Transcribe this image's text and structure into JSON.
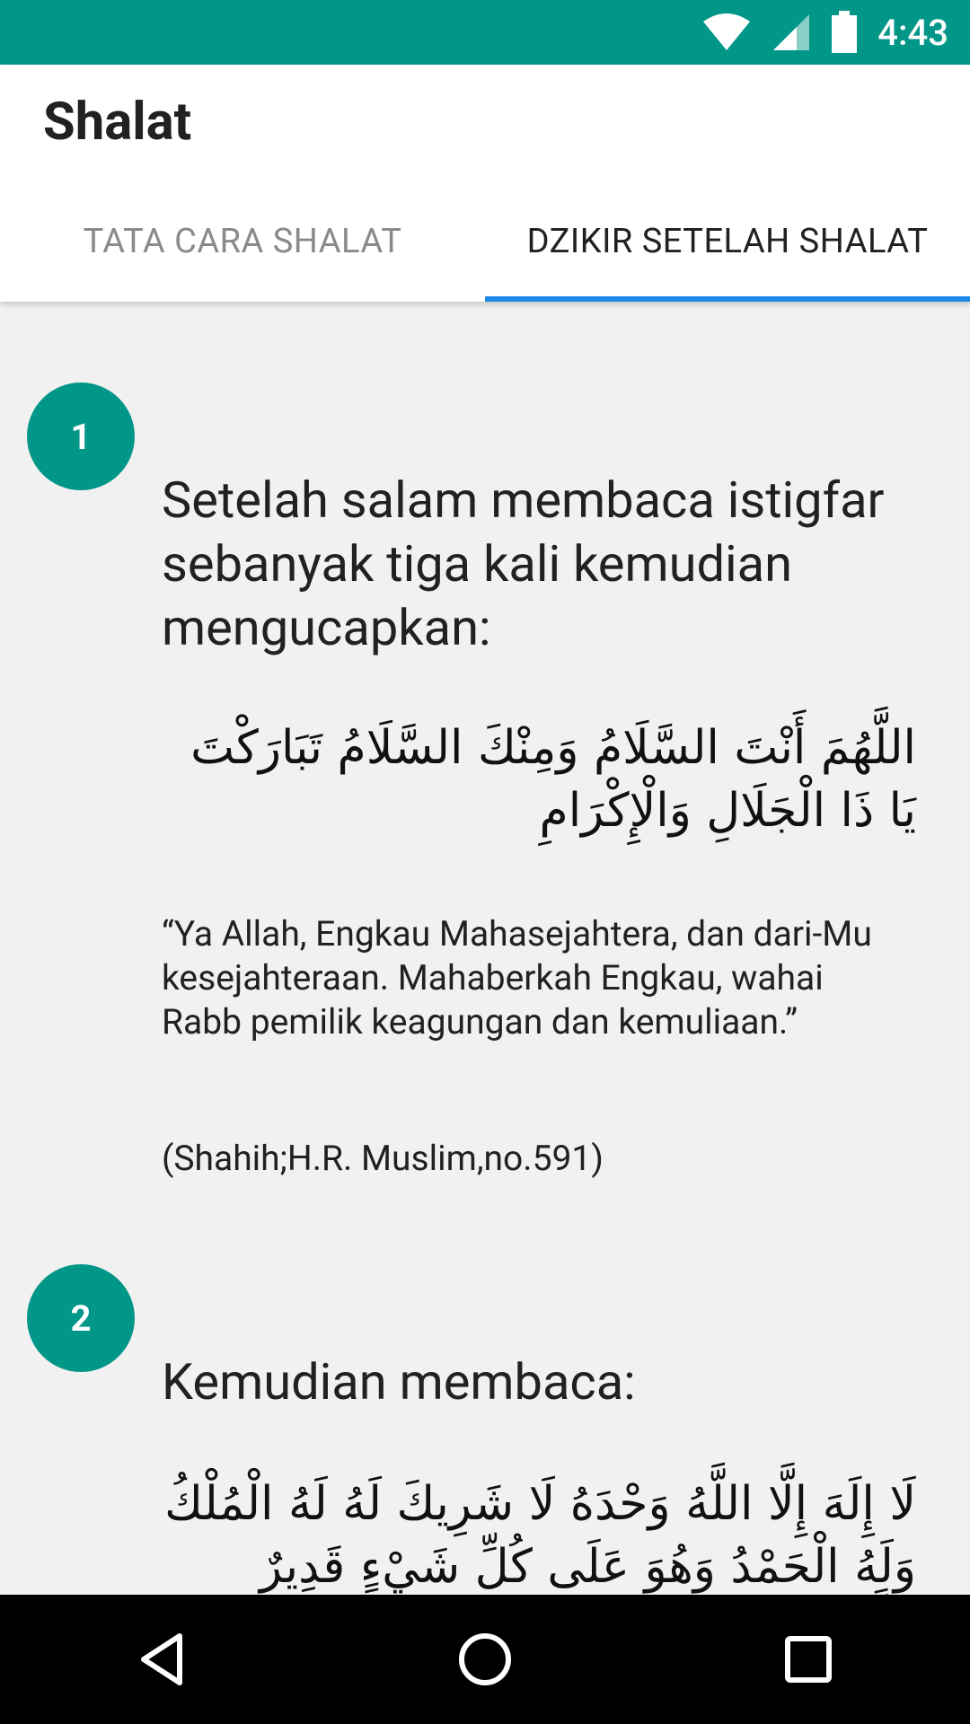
{
  "status_bar": {
    "time": "4:43",
    "icons": [
      "wifi-icon",
      "signal-icon",
      "battery-icon"
    ]
  },
  "app_bar": {
    "title": "Shalat",
    "tabs": [
      {
        "label": "TATA CARA SHALAT",
        "active": false
      },
      {
        "label": "DZIKIR SETELAH SHALAT",
        "active": true
      }
    ]
  },
  "steps": [
    {
      "number": "1",
      "heading": "Setelah salam membaca istigfar sebanyak tiga kali kemudian mengucapkan:",
      "arabic": "اللَّهُمَ أَنْتَ السَّلَامُ وَمِنْكَ السَّلَامُ تَبَارَكْتَ يَا ذَا الْجَلَالِ وَالْإِكْرَامِ",
      "translation": "“Ya Allah, Engkau Mahasejahtera, dan dari-Mu kesejahteraan. Mahaberkah Engkau, wahai Rabb pemilik keagungan dan kemuliaan.”",
      "source": "(Shahih;H.R. Muslim,no.591)"
    },
    {
      "number": "2",
      "heading": "Kemudian membaca:",
      "arabic": "لَا إِلَهَ إِلَّا اللَّهُ وَحْدَهُ لَا شَرِيكَ لَهُ لَهُ الْمُلْكُ وَلَهُ الْحَمْدُ وَهُوَ عَلَى كُلِّ شَيْءٍ قَدِيرٌ اللَّهُمَّ"
    }
  ],
  "nav_bar": {
    "buttons": [
      "back-icon",
      "home-icon",
      "recents-icon"
    ]
  },
  "colors": {
    "primary": "#009688",
    "tab_indicator": "#1e88e5",
    "background": "#f1f1f1"
  }
}
